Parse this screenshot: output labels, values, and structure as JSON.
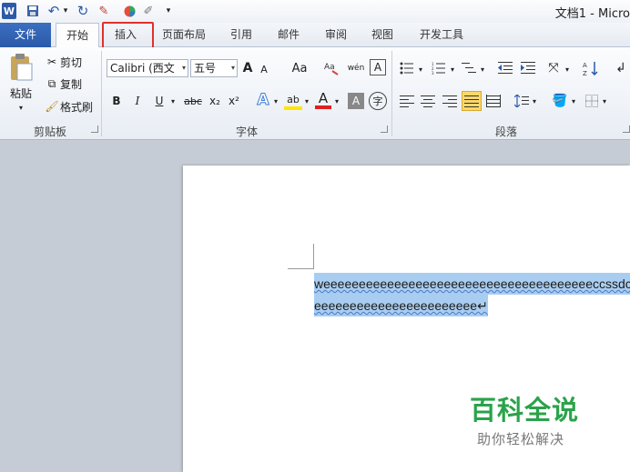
{
  "window": {
    "title": "文档1 - Micro"
  },
  "qat": {
    "word_icon": "W",
    "dropdown_glyph": "▾"
  },
  "tabs": [
    {
      "label": "文件"
    },
    {
      "label": "开始"
    },
    {
      "label": "插入"
    },
    {
      "label": "页面布局"
    },
    {
      "label": "引用"
    },
    {
      "label": "邮件"
    },
    {
      "label": "审阅"
    },
    {
      "label": "视图"
    },
    {
      "label": "开发工具"
    }
  ],
  "clipboard": {
    "paste": "粘贴",
    "cut": "剪切",
    "copy": "复制",
    "format_painter": "格式刷",
    "group_label": "剪贴板"
  },
  "font": {
    "family": "Calibri (西文",
    "size": "五号",
    "grow": "A",
    "shrink": "A",
    "case": "Aa",
    "bold": "B",
    "italic": "I",
    "underline": "U",
    "strike": "abc",
    "subscript": "x₂",
    "superscript": "x²",
    "text_effect": "A",
    "highlight": "ab",
    "font_color": "A",
    "char_shading": "A",
    "enclose": "字",
    "pinyin": "wén",
    "group_label": "字体"
  },
  "paragraph": {
    "group_label": "段落"
  },
  "document": {
    "line1": "weeeeeeeeeeeeeeeeeeeeeeeeeeeeeeeeeeeeeeccssdcccc",
    "line2": "eeeeeeeeeeeeeeeeeeeeeee↵"
  },
  "watermark": {
    "title": "百科全说",
    "subtitle": "助你轻松解决"
  },
  "colors": {
    "file_tab": "#2b5aa8",
    "highlight_box": "#e03030",
    "selection": "#a9cdf0",
    "watermark_green": "#2aa34a"
  }
}
